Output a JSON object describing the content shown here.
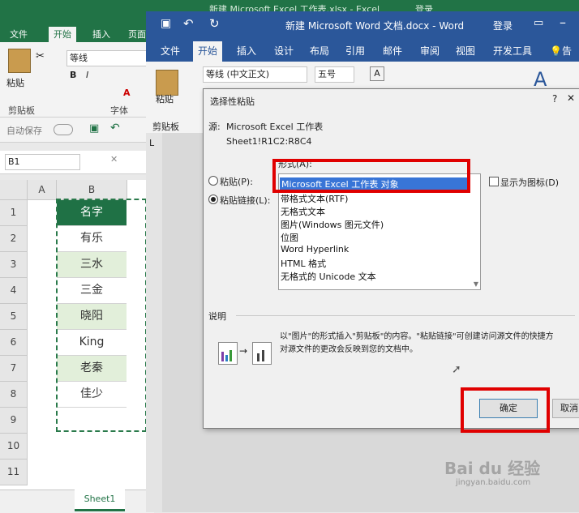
{
  "excel": {
    "title": "新建 Microsoft Excel 工作表.xlsx - Excel",
    "login": "登录",
    "tabs": [
      "文件",
      "开始",
      "插入",
      "页面"
    ],
    "font_name": "等线",
    "ribbon": {
      "paste": "粘贴",
      "clipboard": "剪贴板",
      "font": "字体"
    },
    "autosave": "自动保存",
    "name_box": "B1",
    "columns": [
      "A",
      "B"
    ],
    "rows": [
      "1",
      "2",
      "3",
      "4",
      "5",
      "6",
      "7",
      "8",
      "9",
      "10",
      "11"
    ],
    "cells": [
      "名字",
      "有乐",
      "三水",
      "三金",
      "晓阳",
      "King",
      "老秦",
      "佳少"
    ],
    "sheet_tab": "Sheet1",
    "accent": "#217346"
  },
  "word": {
    "title": "新建 Microsoft Word 文档.docx - Word",
    "login": "登录",
    "tabs": [
      "文件",
      "开始",
      "插入",
      "设计",
      "布局",
      "引用",
      "邮件",
      "审阅",
      "视图",
      "开发工具",
      "告诉"
    ],
    "font_name": "等线 (中文正文)",
    "font_size": "五号",
    "ribbon": {
      "paste": "粘贴",
      "clipboard": "剪贴板"
    },
    "ruler_mark": "L",
    "accent": "#2b579a"
  },
  "dialog": {
    "title": "选择性粘贴",
    "help": "?",
    "source_label": "源:",
    "source_value": "Microsoft Excel 工作表",
    "source_ref": "Sheet1!R1C2:R8C4",
    "format_label": "形式(A):",
    "radio_paste": "粘贴(P):",
    "radio_paste_link": "粘贴链接(L):",
    "formats": [
      "Microsoft Excel 工作表 对象",
      "带格式文本(RTF)",
      "无格式文本",
      "图片(Windows 图元文件)",
      "位图",
      "Word Hyperlink",
      "HTML 格式",
      "无格式的 Unicode 文本"
    ],
    "show_icon": "显示为图标(D)",
    "desc_label": "说明",
    "desc_line1": "以\"图片\"的形式插入\"剪贴板\"的内容。\"粘贴链接\"可创建访问源文件的快捷方",
    "desc_line2": "对源文件的更改会反映到您的文档中。",
    "ok": "确定",
    "cancel": "取消"
  },
  "watermark": {
    "brand": "Bai du 经验",
    "url": "jingyan.baidu.com"
  }
}
